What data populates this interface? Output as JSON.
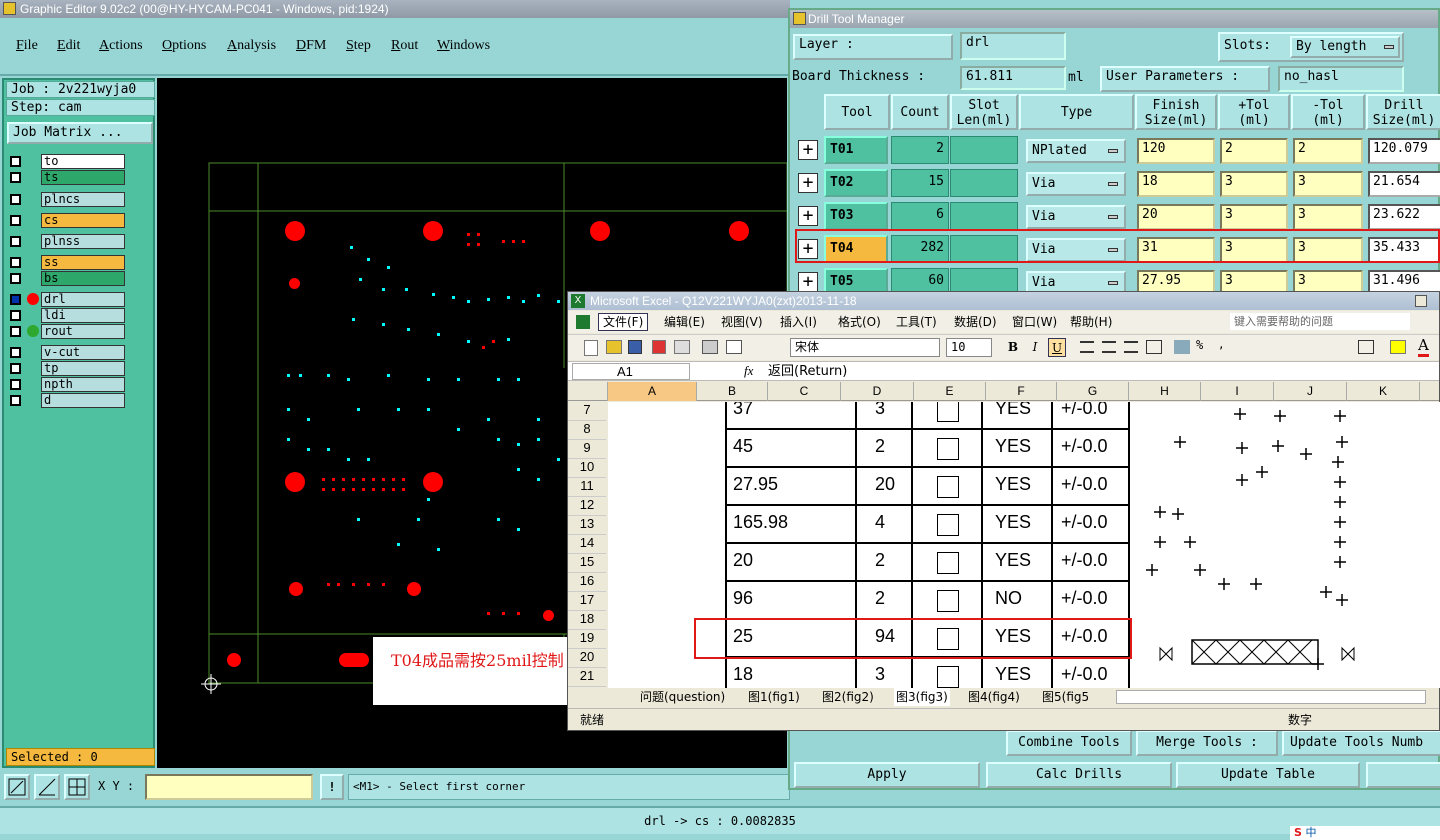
{
  "ge": {
    "title": "Graphic Editor 9.02c2 (00@HY-HYCAM-PC041 - Windows, pid:1924)",
    "menu": [
      "File",
      "Edit",
      "Actions",
      "Options",
      "Analysis",
      "DFM",
      "Step",
      "Rout",
      "Windows"
    ],
    "job": "Job : 2v221wyja0",
    "step": "Step: cam",
    "job_matrix": "Job Matrix ...",
    "layers": [
      {
        "name": "to",
        "color": "#ffffff"
      },
      {
        "name": "ts",
        "color": "#2ea86a"
      },
      {
        "name": "plncs",
        "color": "#b6dede"
      },
      {
        "name": "cs",
        "color": "#f4b93e"
      },
      {
        "name": "plnss",
        "color": "#b6dede"
      },
      {
        "name": "ss",
        "color": "#f4b93e"
      },
      {
        "name": "bs",
        "color": "#2ea86a"
      },
      {
        "name": "drl",
        "color": "#b6dede"
      },
      {
        "name": "ldi",
        "color": "#b6dede"
      },
      {
        "name": "rout",
        "color": "#b6dede"
      },
      {
        "name": "v-cut",
        "color": "#b6dede"
      },
      {
        "name": "tp",
        "color": "#b6dede"
      },
      {
        "name": "npth",
        "color": "#b6dede"
      },
      {
        "name": "d",
        "color": "#b6dede"
      }
    ],
    "selected": "Selected : 0",
    "xy_label": "X Y :",
    "prompt": "<M1> - Select first corner",
    "status": "drl -> cs : 0.0082835"
  },
  "dtm": {
    "title": "Drill Tool Manager",
    "layer_label": "Layer           :",
    "layer_value": "drl",
    "slots_label": "Slots:",
    "slots_value": "By length",
    "board_label": "Board Thickness :",
    "board_value": "61.811",
    "board_unit": "ml",
    "user_params_label": "User Parameters :",
    "user_params_value": "no_hasl",
    "headers": [
      "Tool",
      "Count",
      "Slot Len(ml)",
      "Type",
      "Finish Size(ml)",
      "+Tol (ml)",
      "-Tol (ml)",
      "Drill Size(ml)"
    ],
    "rows": [
      {
        "tool": "T01",
        "count": "2",
        "type": "NPlated",
        "finish": "120",
        "ptol": "2",
        "mtol": "2",
        "drill": "120.079"
      },
      {
        "tool": "T02",
        "count": "15",
        "type": "Via",
        "finish": "18",
        "ptol": "3",
        "mtol": "3",
        "drill": "21.654"
      },
      {
        "tool": "T03",
        "count": "6",
        "type": "Via",
        "finish": "20",
        "ptol": "3",
        "mtol": "3",
        "drill": "23.622"
      },
      {
        "tool": "T04",
        "count": "282",
        "type": "Via",
        "finish": "31",
        "ptol": "3",
        "mtol": "3",
        "drill": "35.433"
      },
      {
        "tool": "T05",
        "count": "60",
        "type": "Via",
        "finish": "27.95",
        "ptol": "3",
        "mtol": "3",
        "drill": "31.496"
      }
    ],
    "btn_combine": "Combine Tools",
    "btn_merge": "Merge Tools :",
    "btn_update_nums": "Update Tools Numb",
    "btn_apply": "Apply",
    "btn_calc": "Calc Drills",
    "btn_update_table": "Update Table"
  },
  "xl": {
    "title": "Microsoft Excel - Q12V221WYJA0(zxt)2013-11-18",
    "menu": [
      "文件(F)",
      "编辑(E)",
      "视图(V)",
      "插入(I)",
      "格式(O)",
      "工具(T)",
      "数据(D)",
      "窗口(W)",
      "帮助(H)"
    ],
    "help_placeholder": "键入需要帮助的问题",
    "font": "宋体",
    "size": "10",
    "cell_ref": "A1",
    "fx": "fx",
    "formula": "返回(Return)",
    "cols": [
      "A",
      "B",
      "C",
      "D",
      "E",
      "F",
      "G",
      "H",
      "I",
      "J",
      "K"
    ],
    "rownums": [
      "7",
      "8",
      "9",
      "10",
      "11",
      "12",
      "13",
      "14",
      "15",
      "16",
      "17",
      "18",
      "19",
      "20",
      "21"
    ],
    "img_rows": [
      {
        "size": "37",
        "count": "3",
        "plated": "YES",
        "tol": "+/-0.0"
      },
      {
        "size": "45",
        "count": "2",
        "plated": "YES",
        "tol": "+/-0.0"
      },
      {
        "size": "27.95",
        "count": "20",
        "plated": "YES",
        "tol": "+/-0.0"
      },
      {
        "size": "165.98",
        "count": "4",
        "plated": "YES",
        "tol": "+/-0.0"
      },
      {
        "size": "20",
        "count": "2",
        "plated": "YES",
        "tol": "+/-0.0"
      },
      {
        "size": "96",
        "count": "2",
        "plated": "NO",
        "tol": "+/-0.0"
      },
      {
        "size": "25",
        "count": "94",
        "plated": "YES",
        "tol": "+/-0.0"
      },
      {
        "size": "18",
        "count": "3",
        "plated": "YES",
        "tol": "+/-0.0"
      }
    ],
    "tabs": [
      "问题(question)",
      "图1(fig1)",
      "图2(fig2)",
      "图3(fig3)",
      "图4(fig4)",
      "图5(fig5"
    ],
    "status_left": "就绪",
    "status_right": "数字"
  },
  "note": "T04成品需按25mil控制",
  "taskbar": "中"
}
